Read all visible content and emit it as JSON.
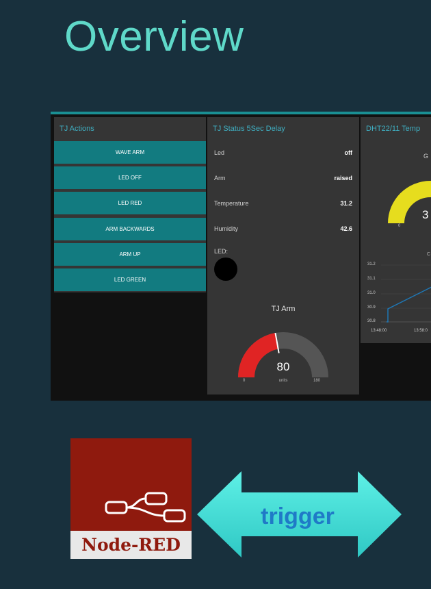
{
  "slide": {
    "title": "Overview"
  },
  "dashboard": {
    "actions": {
      "title": "TJ Actions",
      "buttons": [
        "WAVE ARM",
        "LED OFF",
        "LED RED",
        "ARM BACKWARDS",
        "ARM UP",
        "LED GREEN"
      ]
    },
    "status": {
      "title": "TJ Status 5Sec Delay",
      "rows": [
        {
          "label": "Led",
          "value": "off"
        },
        {
          "label": "Arm",
          "value": "raised"
        },
        {
          "label": "Temperature",
          "value": "31.2"
        },
        {
          "label": "Humidity",
          "value": "42.6"
        }
      ],
      "led_label": "LED:",
      "led_color": "#000000",
      "arm_gauge": {
        "title": "TJ Arm",
        "value": "80",
        "units": "units",
        "min": "0",
        "max": "180",
        "fill_fraction": 0.444,
        "fill_color": "#e02424"
      }
    },
    "dht": {
      "title": "DHT22/11 Temp",
      "gauge_label": "G",
      "gauge_value": "3",
      "gauge_min": "0",
      "gauge_color": "#e6dd1e",
      "chart_label": "C",
      "chart_data": {
        "type": "line",
        "yticks": [
          "31.2",
          "31.1",
          "31.0",
          "30.9",
          "30.8"
        ],
        "xticks": [
          "13:48:00",
          "13:58:0"
        ],
        "series_color": "#1f77b4"
      }
    }
  },
  "logo": {
    "text": "Node-RED"
  },
  "arrow": {
    "label": "trigger",
    "color": "#3fd6cf"
  }
}
